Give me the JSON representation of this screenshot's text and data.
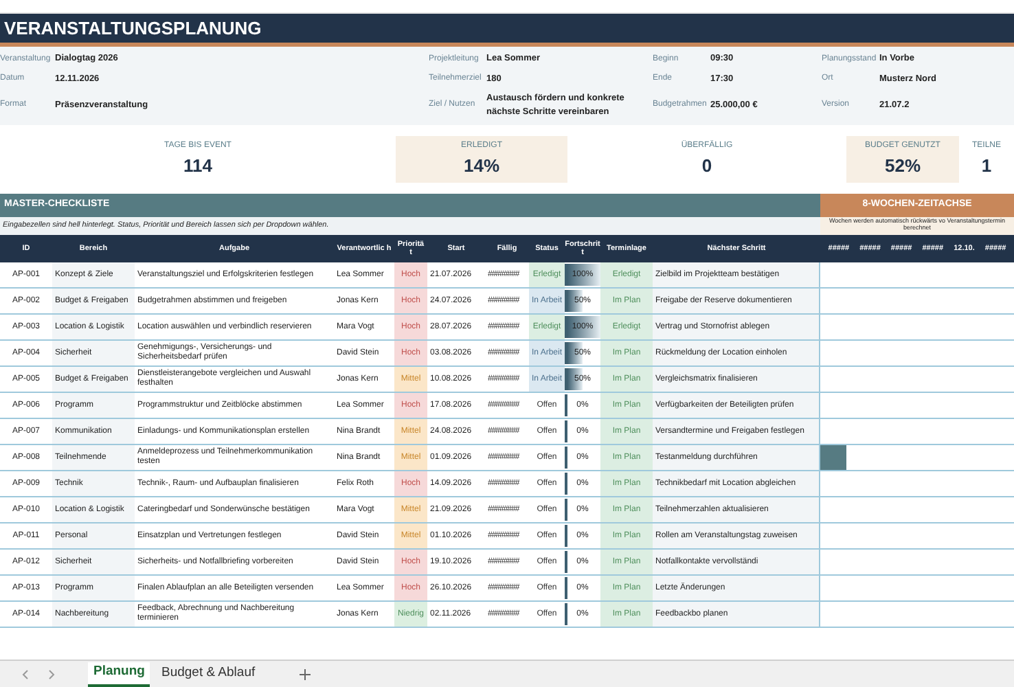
{
  "title": "VERANSTALTUNGSPLANUNG",
  "info": [
    [
      {
        "label": "Veranstaltung",
        "value": "Dialogtag 2026"
      },
      {
        "label": "Projektleitung",
        "value": "Lea Sommer"
      },
      {
        "label": "Beginn",
        "value": "09:30"
      },
      {
        "label": "Planungsstand",
        "value": "In Vorbe"
      }
    ],
    [
      {
        "label": "Datum",
        "value": "12.11.2026"
      },
      {
        "label": "Teilnehmerziel",
        "value": "180"
      },
      {
        "label": "Ende",
        "value": "17:30"
      },
      {
        "label": "Ort",
        "value": "Musterz Nord"
      }
    ],
    [
      {
        "label": "Format",
        "value": "Präsenzveranstaltung"
      },
      {
        "label": "Ziel / Nutzen",
        "value": "Austausch fördern und konkrete nächste Schritte vereinbaren"
      },
      {
        "label": "Budgetrahmen",
        "value": "25.000,00 €"
      },
      {
        "label": "Version",
        "value": "21.07.2"
      }
    ]
  ],
  "kpis": [
    {
      "label": "TAGE BIS EVENT",
      "value": "114",
      "highlighted": false
    },
    {
      "label": "ERLEDIGT",
      "value": "14%",
      "highlighted": true
    },
    {
      "label": "ÜBERFÄLLIG",
      "value": "0",
      "highlighted": false
    },
    {
      "label": "BUDGET GENUTZT",
      "value": "52%",
      "highlighted": true
    },
    {
      "label": "TEILNE",
      "value": "1",
      "highlighted": false
    }
  ],
  "checklist": {
    "title": "MASTER-CHECKLISTE",
    "note": "Eingabezellen sind hell hinterlegt. Status, Priorität und Bereich lassen sich per Dropdown wählen.",
    "columns": [
      "ID",
      "Bereich",
      "Aufgabe",
      "Verantwortlic h",
      "Prioritä t",
      "Start",
      "Fällig",
      "Status",
      "Fortschrit t",
      "Terminlage",
      "Nächster Schritt"
    ],
    "rows": [
      {
        "id": "AP-001",
        "area": "Konzept & Ziele",
        "task": "Veranstaltungsziel und Erfolgskriterien festlegen",
        "owner": "Lea Sommer",
        "priority": {
          "label": "Hoch",
          "kind": "high"
        },
        "start": "21.07.2026",
        "due": "########",
        "status": {
          "label": "Erledigt",
          "kind": "done"
        },
        "progress": {
          "label": "100%",
          "level": 1
        },
        "schedule": "Erledigt",
        "next": "Zielbild im Projektteam bestätigen",
        "gantt": false
      },
      {
        "id": "AP-002",
        "area": "Budget & Freigaben",
        "task": "Budgetrahmen abstimmen und freigeben",
        "owner": "Jonas Kern",
        "priority": {
          "label": "Hoch",
          "kind": "high"
        },
        "start": "24.07.2026",
        "due": "########",
        "status": {
          "label": "In Arbeit",
          "kind": "active"
        },
        "progress": {
          "label": "50%",
          "level": 0.5
        },
        "schedule": "Im Plan",
        "next": "Freigabe der Reserve dokumentieren",
        "gantt": false
      },
      {
        "id": "AP-003",
        "area": "Location & Logistik",
        "task": "Location auswählen und verbindlich reservieren",
        "owner": "Mara Vogt",
        "priority": {
          "label": "Hoch",
          "kind": "high"
        },
        "start": "28.07.2026",
        "due": "########",
        "status": {
          "label": "Erledigt",
          "kind": "done"
        },
        "progress": {
          "label": "100%",
          "level": 1
        },
        "schedule": "Erledigt",
        "next": "Vertrag und Stornofrist ablegen",
        "gantt": false
      },
      {
        "id": "AP-004",
        "area": "Sicherheit",
        "task": "Genehmigungs-, Versicherungs- und Sicherheitsbedarf prüfen",
        "owner": "David Stein",
        "priority": {
          "label": "Hoch",
          "kind": "high"
        },
        "start": "03.08.2026",
        "due": "########",
        "status": {
          "label": "In Arbeit",
          "kind": "active"
        },
        "progress": {
          "label": "50%",
          "level": 0.5
        },
        "schedule": "Im Plan",
        "next": "Rückmeldung der Location einholen",
        "gantt": false
      },
      {
        "id": "AP-005",
        "area": "Budget & Freigaben",
        "task": "Dienstleisterangebote vergleichen und Auswahl festhalten",
        "owner": "Jonas Kern",
        "priority": {
          "label": "Mittel",
          "kind": "medium"
        },
        "start": "10.08.2026",
        "due": "########",
        "status": {
          "label": "In Arbeit",
          "kind": "active"
        },
        "progress": {
          "label": "50%",
          "level": 0.5
        },
        "schedule": "Im Plan",
        "next": "Vergleichsmatrix finalisieren",
        "gantt": false
      },
      {
        "id": "AP-006",
        "area": "Programm",
        "task": "Programmstruktur und Zeitblöcke abstimmen",
        "owner": "Lea Sommer",
        "priority": {
          "label": "Hoch",
          "kind": "high"
        },
        "start": "17.08.2026",
        "due": "########",
        "status": {
          "label": "Offen",
          "kind": "open"
        },
        "progress": {
          "label": "0%",
          "level": 0
        },
        "schedule": "Im Plan",
        "next": "Verfügbarkeiten der Beteiligten prüfen",
        "gantt": false
      },
      {
        "id": "AP-007",
        "area": "Kommunikation",
        "task": "Einladungs- und Kommunikationsplan erstellen",
        "owner": "Nina Brandt",
        "priority": {
          "label": "Mittel",
          "kind": "medium"
        },
        "start": "24.08.2026",
        "due": "########",
        "status": {
          "label": "Offen",
          "kind": "open"
        },
        "progress": {
          "label": "0%",
          "level": 0
        },
        "schedule": "Im Plan",
        "next": "Versandtermine und Freigaben festlegen",
        "gantt": false
      },
      {
        "id": "AP-008",
        "area": "Teilnehmende",
        "task": "Anmeldeprozess und Teilnehmerkommunikation testen",
        "owner": "Nina Brandt",
        "priority": {
          "label": "Mittel",
          "kind": "medium"
        },
        "start": "01.09.2026",
        "due": "########",
        "status": {
          "label": "Offen",
          "kind": "open"
        },
        "progress": {
          "label": "0%",
          "level": 0
        },
        "schedule": "Im Plan",
        "next": "Testanmeldung durchführen",
        "gantt": true
      },
      {
        "id": "AP-009",
        "area": "Technik",
        "task": "Technik-, Raum- und Aufbauplan finalisieren",
        "owner": "Felix Roth",
        "priority": {
          "label": "Hoch",
          "kind": "high"
        },
        "start": "14.09.2026",
        "due": "########",
        "status": {
          "label": "Offen",
          "kind": "open"
        },
        "progress": {
          "label": "0%",
          "level": 0
        },
        "schedule": "Im Plan",
        "next": "Technikbedarf mit Location abgleichen",
        "gantt": false
      },
      {
        "id": "AP-010",
        "area": "Location & Logistik",
        "task": "Cateringbedarf und Sonderwünsche bestätigen",
        "owner": "Mara Vogt",
        "priority": {
          "label": "Mittel",
          "kind": "medium"
        },
        "start": "21.09.2026",
        "due": "########",
        "status": {
          "label": "Offen",
          "kind": "open"
        },
        "progress": {
          "label": "0%",
          "level": 0
        },
        "schedule": "Im Plan",
        "next": "Teilnehmerzahlen aktualisieren",
        "gantt": false
      },
      {
        "id": "AP-011",
        "area": "Personal",
        "task": "Einsatzplan und Vertretungen festlegen",
        "owner": "David Stein",
        "priority": {
          "label": "Mittel",
          "kind": "medium"
        },
        "start": "01.10.2026",
        "due": "########",
        "status": {
          "label": "Offen",
          "kind": "open"
        },
        "progress": {
          "label": "0%",
          "level": 0
        },
        "schedule": "Im Plan",
        "next": "Rollen am Veranstaltungstag zuweisen",
        "gantt": false
      },
      {
        "id": "AP-012",
        "area": "Sicherheit",
        "task": "Sicherheits- und Notfallbriefing vorbereiten",
        "owner": "David Stein",
        "priority": {
          "label": "Hoch",
          "kind": "high"
        },
        "start": "19.10.2026",
        "due": "########",
        "status": {
          "label": "Offen",
          "kind": "open"
        },
        "progress": {
          "label": "0%",
          "level": 0
        },
        "schedule": "Im Plan",
        "next": "Notfallkontakte vervollständi",
        "gantt": false
      },
      {
        "id": "AP-013",
        "area": "Programm",
        "task": "Finalen Ablaufplan an alle Beteiligten versenden",
        "owner": "Lea Sommer",
        "priority": {
          "label": "Hoch",
          "kind": "high"
        },
        "start": "26.10.2026",
        "due": "########",
        "status": {
          "label": "Offen",
          "kind": "open"
        },
        "progress": {
          "label": "0%",
          "level": 0
        },
        "schedule": "Im Plan",
        "next": "Letzte Änderungen",
        "gantt": false
      },
      {
        "id": "AP-014",
        "area": "Nachbereitung",
        "task": "Feedback, Abrechnung und Nachbereitung terminieren",
        "owner": "Jonas Kern",
        "priority": {
          "label": "Niedrig",
          "kind": "low"
        },
        "start": "02.11.2026",
        "due": "########",
        "status": {
          "label": "Offen",
          "kind": "open"
        },
        "progress": {
          "label": "0%",
          "level": 0
        },
        "schedule": "Im Plan",
        "next": "Feedbackbo planen",
        "gantt": false
      }
    ]
  },
  "timeline": {
    "title": "8-WOCHEN-ZEITACHSE",
    "note": "Wochen werden automatisch rückwärts vo Veranstaltungstermin berechnet",
    "columns": [
      "#####",
      "#####",
      "#####",
      "#####",
      "12.10.",
      "#####"
    ]
  },
  "sheets": [
    {
      "label": "Planung",
      "selected": true
    },
    {
      "label": "Budget & Ablauf",
      "selected": false
    }
  ]
}
